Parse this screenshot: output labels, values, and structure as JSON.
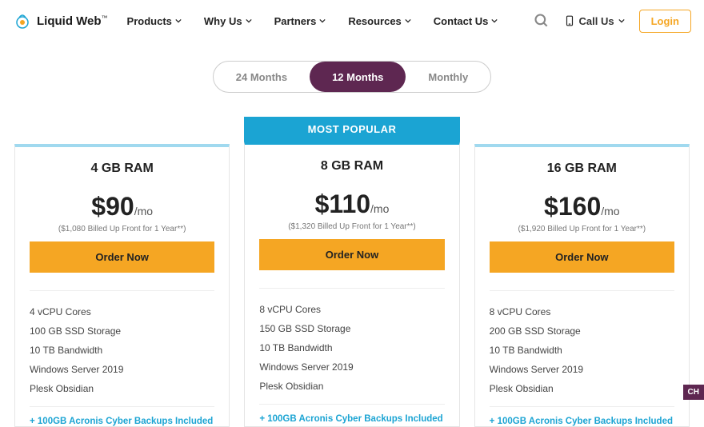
{
  "brand": {
    "name": "Liquid Web",
    "tm": "™"
  },
  "nav": {
    "items": [
      {
        "label": "Products"
      },
      {
        "label": "Why Us"
      },
      {
        "label": "Partners"
      },
      {
        "label": "Resources"
      },
      {
        "label": "Contact Us"
      }
    ],
    "callus": "Call Us",
    "login": "Login"
  },
  "tabs": {
    "items": [
      {
        "label": "24 Months",
        "active": false
      },
      {
        "label": "12 Months",
        "active": true
      },
      {
        "label": "Monthly",
        "active": false
      }
    ]
  },
  "popular_label": "MOST POPULAR",
  "order_label": "Order Now",
  "price_suffix": "/mo",
  "backup_note": "+ 100GB Acronis Cyber Backups Included",
  "plans": [
    {
      "title": "4 GB RAM",
      "price": "$90",
      "billed": "($1,080 Billed Up Front for 1 Year**)",
      "popular": false,
      "features": [
        "4 vCPU Cores",
        "100 GB SSD Storage",
        "10 TB Bandwidth",
        "Windows Server 2019",
        "Plesk Obsidian"
      ]
    },
    {
      "title": "8 GB RAM",
      "price": "$110",
      "billed": "($1,320 Billed Up Front for 1 Year**)",
      "popular": true,
      "features": [
        "8 vCPU Cores",
        "150 GB SSD Storage",
        "10 TB Bandwidth",
        "Windows Server 2019",
        "Plesk Obsidian"
      ]
    },
    {
      "title": "16 GB RAM",
      "price": "$160",
      "billed": "($1,920 Billed Up Front for 1 Year**)",
      "popular": false,
      "features": [
        "8 vCPU Cores",
        "200 GB SSD Storage",
        "10 TB Bandwidth",
        "Windows Server 2019",
        "Plesk Obsidian"
      ]
    }
  ],
  "chat": "CH"
}
